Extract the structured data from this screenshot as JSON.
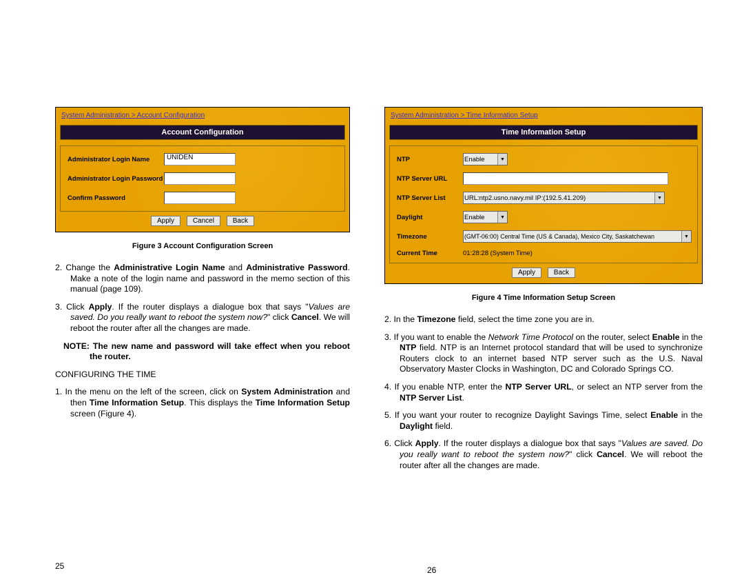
{
  "left": {
    "shot": {
      "breadcrumb": "System Administration > Account Configuration",
      "banner": "Account Configuration",
      "rows": {
        "login_name_label": "Administrator Login Name",
        "login_name_value": "UNIDEN",
        "login_pw_label": "Administrator Login Password",
        "confirm_pw_label": "Confirm Password"
      },
      "buttons": {
        "apply": "Apply",
        "cancel": "Cancel",
        "back": "Back"
      }
    },
    "caption": "Figure 3    Account Configuration Screen",
    "li2_a": "2.   Change   the   ",
    "li2_b": "Administrative   Login   Name",
    "li2_c": "   and   ",
    "li2_d": "Administrative Password",
    "li2_e": ".   Make a note of the login name and password in the memo section of this manual (page 109).",
    "li3_a": "3.   Click ",
    "li3_b": "Apply",
    "li3_c": ".   If the router displays a dialogue box that says \"",
    "li3_d": "Values are saved. Do you really want to reboot the system now?",
    "li3_e": "\" click ",
    "li3_f": "Cancel",
    "li3_g": ".   We will reboot the router after all the changes are made.",
    "note_a": "NOTE:  The new name and password will take effect when you reboot the router.",
    "section": "CONFIGURING THE TIME",
    "li1_a": "1.   In the menu on the left of the screen, click on ",
    "li1_b": "System Administration",
    "li1_c": " and then ",
    "li1_d": "Time Information Setup",
    "li1_e": ". This displays the ",
    "li1_f": "Time Information Setup",
    "li1_g": " screen (Figure 4).",
    "pagenum": "25"
  },
  "right": {
    "shot": {
      "breadcrumb": "System Administration > Time Information Setup",
      "banner": "Time Information Setup",
      "rows": {
        "ntp_label": "NTP",
        "ntp_value": "Enable",
        "url_label": "NTP Server URL",
        "list_label": "NTP Server List",
        "list_value": "URL:ntp2.usno.navy.mil   IP:(192.5.41.209)",
        "daylight_label": "Daylight",
        "daylight_value": "Enable",
        "tz_label": "Timezone",
        "tz_value": "(GMT-06:00) Central Time (US & Canada), Mexico City, Saskatchewan",
        "curtime_label": "Current Time",
        "curtime_value": "01:28:28 (System Time)"
      },
      "buttons": {
        "apply": "Apply",
        "back": "Back"
      }
    },
    "caption": "Figure 4    Time Information Setup Screen",
    "li2_a": "2.   In the ",
    "li2_b": "Timezone",
    "li2_c": " field, select the time zone you are in.",
    "li3_a": "3.   If you want to enable the ",
    "li3_b": "Network Time Protocol",
    "li3_c": " on the router, select ",
    "li3_d": "Enable",
    "li3_e": " in the ",
    "li3_f": "NTP",
    "li3_g": " field. NTP is an Internet protocol standard that will be used to synchronize Routers clock to an internet based NTP server such as the U.S. Naval Observatory Master Clocks in Washington, DC and Colorado Springs CO.",
    "li4_a": "4.   If you enable NTP, enter the ",
    "li4_b": "NTP Server URL",
    "li4_c": ", or select an NTP server from the ",
    "li4_d": "NTP Server List",
    "li4_e": ".",
    "li5_a": "5.   If you want your router to recognize Daylight Savings Time, select ",
    "li5_b": "Enable",
    "li5_c": " in the ",
    "li5_d": "Daylight",
    "li5_e": " field.",
    "li6_a": "6.   Click ",
    "li6_b": "Apply",
    "li6_c": ".   If the router displays a dialogue box that says \"",
    "li6_d": "Values are saved. Do you really want to reboot the system now?",
    "li6_e": "\" click ",
    "li6_f": "Cancel",
    "li6_g": ".   We will reboot the router after all the changes are made.",
    "pagenum": "26"
  }
}
